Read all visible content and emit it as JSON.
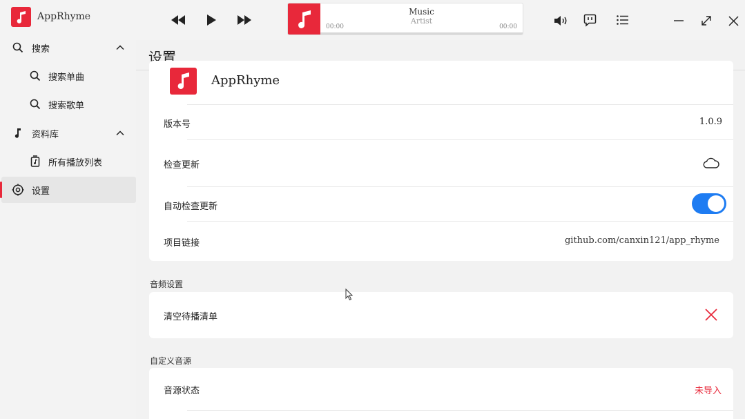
{
  "app": {
    "name": "AppRhyme"
  },
  "sidebar": {
    "search": {
      "label": "搜索"
    },
    "search_song": {
      "label": "搜索单曲"
    },
    "search_playlist": {
      "label": "搜索歌单"
    },
    "library": {
      "label": "资料库"
    },
    "all_playlists": {
      "label": "所有播放列表"
    },
    "settings": {
      "label": "设置"
    }
  },
  "player": {
    "title": "Music",
    "artist": "Artist",
    "time_current": "00:00",
    "time_total": "00:00",
    "progress": 0
  },
  "main": {
    "page_title": "设置",
    "about": {
      "app_name": "AppRhyme",
      "version_label": "版本号",
      "version_value": "1.0.9",
      "check_update_label": "检查更新",
      "auto_check_label": "自动检查更新",
      "auto_check_on": true,
      "project_link_label": "项目链接",
      "project_link_value": "github.com/canxin121/app_rhyme"
    },
    "audio_section": {
      "label": "音频设置",
      "clear_queue_label": "清空待播清单"
    },
    "custom_source_section": {
      "label": "自定义音源",
      "status_label": "音源状态",
      "status_value": "未导入"
    }
  },
  "colors": {
    "accent": "#e8283a",
    "toggle": "#1e7cf2"
  }
}
